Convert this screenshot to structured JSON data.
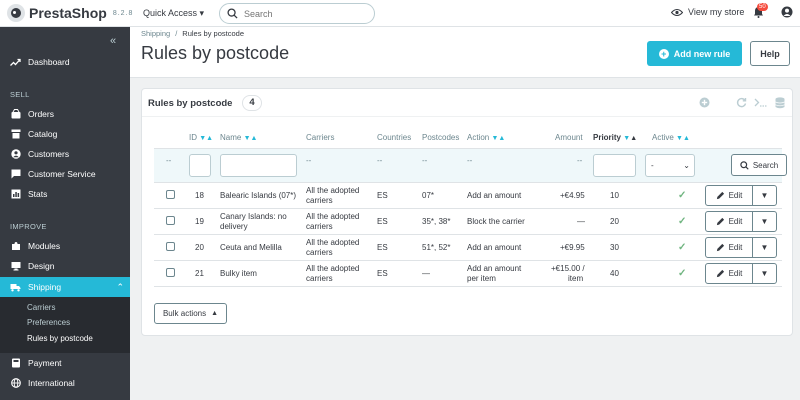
{
  "app": {
    "logo": "PrestaShop",
    "version": "8.2.8",
    "quick_access": "Quick Access",
    "search_placeholder": "Search",
    "view_store": "View my store",
    "notifications_count": "50"
  },
  "sidebar": {
    "items": [
      {
        "label": "Dashboard",
        "icon": "trending-up-icon"
      },
      {
        "label": "Orders",
        "icon": "inbox-icon"
      },
      {
        "label": "Catalog",
        "icon": "store-icon"
      },
      {
        "label": "Customers",
        "icon": "account-icon"
      },
      {
        "label": "Customer Service",
        "icon": "chat-icon"
      },
      {
        "label": "Stats",
        "icon": "stats-icon"
      },
      {
        "label": "Modules",
        "icon": "puzzle-icon"
      },
      {
        "label": "Design",
        "icon": "desktop-icon"
      },
      {
        "label": "Shipping",
        "icon": "truck-icon"
      },
      {
        "label": "Payment",
        "icon": "payment-icon"
      },
      {
        "label": "International",
        "icon": "globe-icon"
      }
    ],
    "sections": [
      "SELL",
      "IMPROVE"
    ],
    "shipping_sub": [
      "Carriers",
      "Preferences",
      "Rules by postcode"
    ]
  },
  "header": {
    "breadcrumb_parent": "Shipping",
    "breadcrumb_current": "Rules by postcode",
    "title": "Rules by postcode",
    "add_button": "Add new rule",
    "help_button": "Help"
  },
  "panel": {
    "title": "Rules by postcode",
    "count": "4",
    "columns": {
      "id": "ID",
      "name": "Name",
      "carriers": "Carriers",
      "countries": "Countries",
      "postcodes": "Postcodes",
      "action": "Action",
      "amount": "Amount",
      "priority": "Priority",
      "active": "Active"
    },
    "filter": {
      "dash": "--",
      "active_selected": "-",
      "search_button": "Search"
    },
    "rows": [
      {
        "id": "18",
        "name_1": "Balearic Islands (07*)",
        "name_2": "",
        "carriers_1": "All the adopted",
        "carriers_2": "carriers",
        "country": "ES",
        "postcodes": "07*",
        "action_1": "Add an amount",
        "action_2": "",
        "amount_1": "+€4.95",
        "amount_2": "",
        "priority": "10"
      },
      {
        "id": "19",
        "name_1": "Canary Islands: no",
        "name_2": "delivery",
        "carriers_1": "All the adopted",
        "carriers_2": "carriers",
        "country": "ES",
        "postcodes": "35*, 38*",
        "action_1": "Block the carrier",
        "action_2": "",
        "amount_1": "—",
        "amount_2": "",
        "priority": "20"
      },
      {
        "id": "20",
        "name_1": "Ceuta and Melilla",
        "name_2": "",
        "carriers_1": "All the adopted",
        "carriers_2": "carriers",
        "country": "ES",
        "postcodes": "51*, 52*",
        "action_1": "Add an amount",
        "action_2": "",
        "amount_1": "+€9.95",
        "amount_2": "",
        "priority": "30"
      },
      {
        "id": "21",
        "name_1": "Bulky item",
        "name_2": "",
        "carriers_1": "All the adopted",
        "carriers_2": "carriers",
        "country": "ES",
        "postcodes": "—",
        "action_1": "Add an amount",
        "action_2": "per item",
        "amount_1": "+€15.00 /",
        "amount_2": "item",
        "priority": "40"
      }
    ],
    "edit_label": "Edit",
    "bulk_actions": "Bulk actions"
  }
}
